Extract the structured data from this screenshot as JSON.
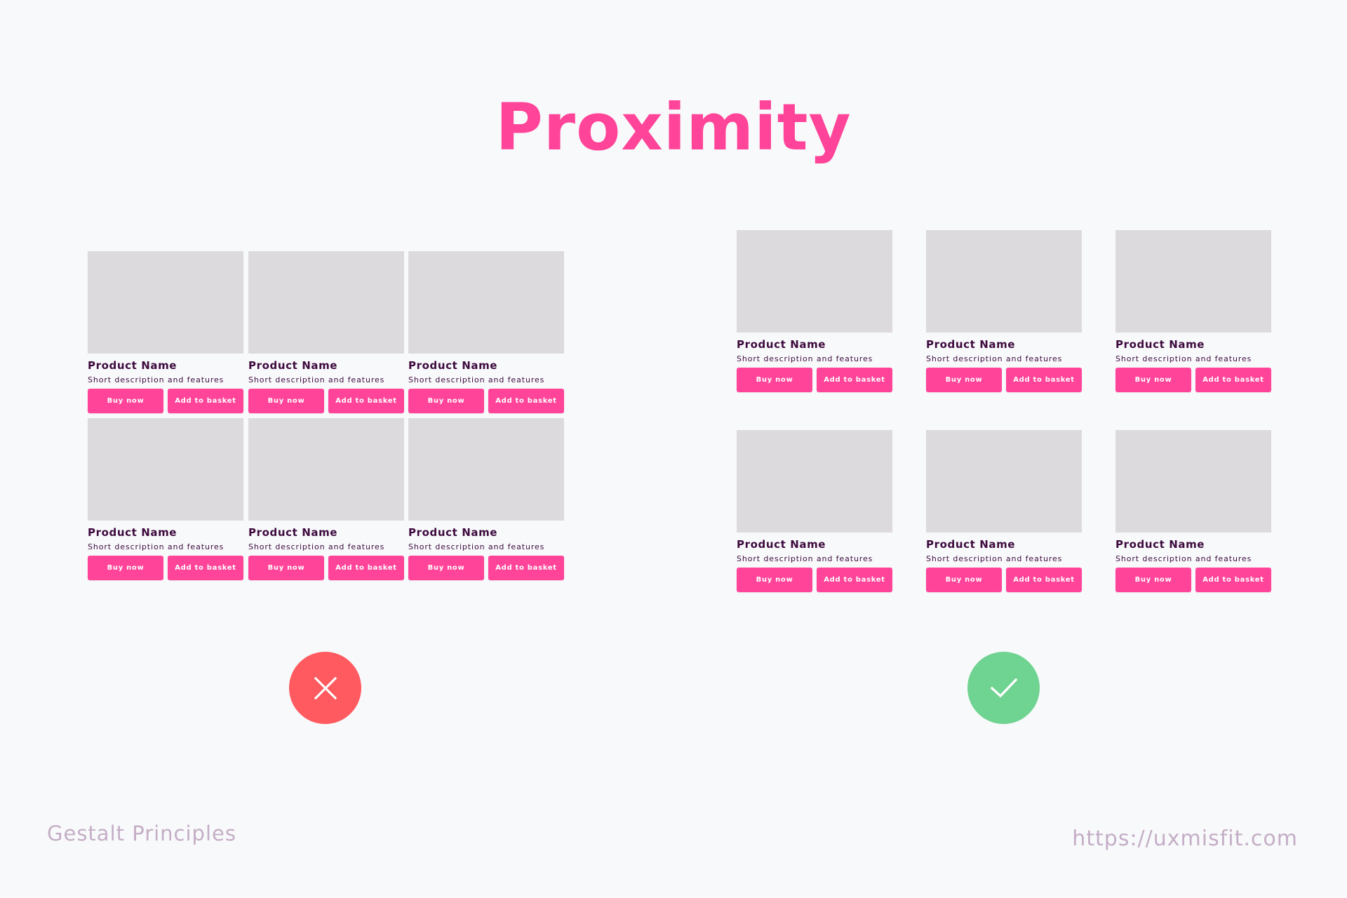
{
  "title": "Proximity",
  "colors": {
    "accent": "#FF4499",
    "background": "#F8F9FB",
    "placeholder": "#DCDADD",
    "text_dark": "#3D0A3E",
    "bad": "#FF5A5F",
    "good": "#6FD391",
    "footer_text": "#C4AEC6"
  },
  "examples": [
    {
      "id": "bad",
      "verdict": "incorrect",
      "verdict_icon": "cross-icon",
      "columns": 3,
      "rows": 2,
      "products": [
        {
          "name": "Product Name",
          "description": "Short description and features",
          "buy_label": "Buy now",
          "basket_label": "Add to basket"
        },
        {
          "name": "Product Name",
          "description": "Short description and features",
          "buy_label": "Buy now",
          "basket_label": "Add to basket"
        },
        {
          "name": "Product Name",
          "description": "Short description and features",
          "buy_label": "Buy now",
          "basket_label": "Add to basket"
        },
        {
          "name": "Product Name",
          "description": "Short description and features",
          "buy_label": "Buy now",
          "basket_label": "Add to basket"
        },
        {
          "name": "Product Name",
          "description": "Short description and features",
          "buy_label": "Buy now",
          "basket_label": "Add to basket"
        },
        {
          "name": "Product Name",
          "description": "Short description and features",
          "buy_label": "Buy now",
          "basket_label": "Add to basket"
        }
      ]
    },
    {
      "id": "good",
      "verdict": "correct",
      "verdict_icon": "check-icon",
      "columns": 3,
      "rows": 2,
      "products": [
        {
          "name": "Product Name",
          "description": "Short description and features",
          "buy_label": "Buy now",
          "basket_label": "Add to basket"
        },
        {
          "name": "Product Name",
          "description": "Short description and features",
          "buy_label": "Buy now",
          "basket_label": "Add to basket"
        },
        {
          "name": "Product Name",
          "description": "Short description and features",
          "buy_label": "Buy now",
          "basket_label": "Add to basket"
        },
        {
          "name": "Product Name",
          "description": "Short description and features",
          "buy_label": "Buy now",
          "basket_label": "Add to basket"
        },
        {
          "name": "Product Name",
          "description": "Short description and features",
          "buy_label": "Buy now",
          "basket_label": "Add to basket"
        },
        {
          "name": "Product Name",
          "description": "Short description and features",
          "buy_label": "Buy now",
          "basket_label": "Add to basket"
        }
      ]
    }
  ],
  "footer": {
    "left_label": "Gestalt Principles",
    "right_label": "https://uxmisfit.com"
  }
}
